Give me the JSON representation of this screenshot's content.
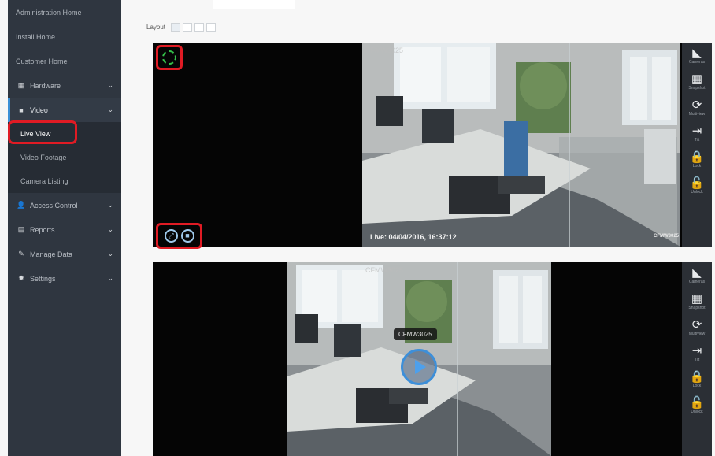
{
  "sidebar": {
    "items": [
      {
        "label": "Administration Home"
      },
      {
        "label": "Install Home"
      },
      {
        "label": "Customer Home"
      },
      {
        "label": "Hardware",
        "icon": "hardware-icon"
      },
      {
        "label": "Video",
        "icon": "video-icon"
      }
    ],
    "video_sub": [
      {
        "label": "Live View"
      },
      {
        "label": "Video Footage"
      },
      {
        "label": "Camera Listing"
      }
    ],
    "after": [
      {
        "label": "Access Control",
        "icon": "user-icon"
      },
      {
        "label": "Reports",
        "icon": "reports-icon"
      },
      {
        "label": "Manage Data",
        "icon": "wrench-icon"
      },
      {
        "label": "Settings",
        "icon": "gear-icon"
      }
    ]
  },
  "layout": {
    "label": "Layout"
  },
  "panel1": {
    "timestamp": "Live: 04/04/2016, 16:37:12",
    "camera_id": "CFMW3025",
    "feed_name": "CFMW3025"
  },
  "panel2": {
    "tooltip": "CFMW3025",
    "feed_name": "CFMW3025"
  },
  "tools": [
    {
      "label": "Cameras"
    },
    {
      "label": "Snapshot"
    },
    {
      "label": "Multiview"
    },
    {
      "label": "Tilt"
    },
    {
      "label": "Lock"
    },
    {
      "label": "Unlock"
    }
  ],
  "colors": {
    "sidebar_bg": "#2f3640",
    "highlight": "#e01b24",
    "spinner": "#35c24a",
    "accent": "#3d8fd9"
  }
}
